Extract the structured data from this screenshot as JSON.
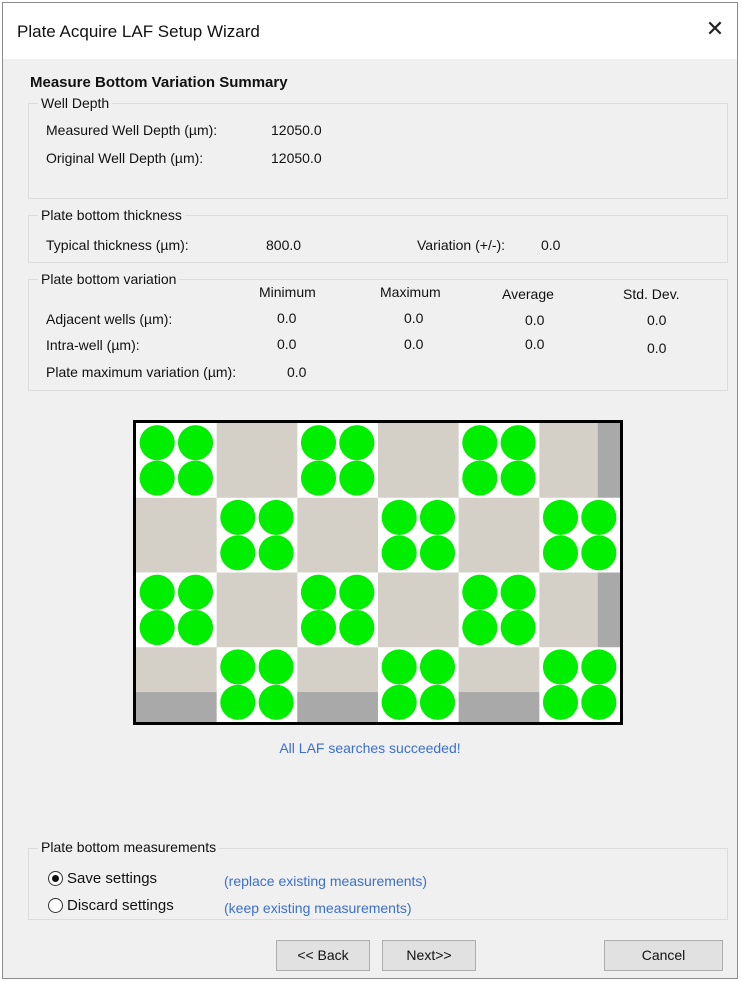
{
  "window": {
    "title": "Plate Acquire LAF Setup Wizard",
    "close_glyph": "✕"
  },
  "heading": "Measure Bottom Variation Summary",
  "well_depth": {
    "title": "Well Depth",
    "measured_label": "Measured Well Depth (µm):",
    "measured_value": "12050.0",
    "original_label": "Original Well Depth (µm):",
    "original_value": "12050.0"
  },
  "thickness": {
    "title": "Plate bottom thickness",
    "typical_label": "Typical thickness (µm):",
    "typical_value": "800.0",
    "variation_label": "Variation (+/-):",
    "variation_value": "0.0"
  },
  "variation": {
    "title": "Plate bottom variation",
    "columns": [
      "Minimum",
      "Maximum",
      "Average",
      "Std. Dev."
    ],
    "rows": [
      {
        "label": "Adjacent wells (µm):",
        "values": [
          "0.0",
          "0.0",
          "0.0",
          "0.0"
        ]
      },
      {
        "label": "Intra-well (µm):",
        "values": [
          "0.0",
          "0.0",
          "0.0",
          "0.0"
        ]
      }
    ],
    "plate_max_label": "Plate maximum variation (µm):",
    "plate_max_value": "0.0"
  },
  "plate_map": {
    "columns": 12,
    "rows": 8,
    "colors": {
      "well_success": "#00ee00",
      "cell_light": "#d4d0c8",
      "cell_dark": "#a9a9a9",
      "cell_white": "#ffffff"
    }
  },
  "status_text": "All LAF searches succeeded!",
  "measurements": {
    "title": "Plate bottom measurements",
    "options": [
      {
        "label": "Save settings",
        "hint": "(replace existing measurements)",
        "selected": true
      },
      {
        "label": "Discard settings",
        "hint": "(keep existing measurements)",
        "selected": false
      }
    ]
  },
  "buttons": {
    "back": "<< Back",
    "next": "Next>>",
    "cancel": "Cancel"
  },
  "accent_color": "#3b6fd1"
}
